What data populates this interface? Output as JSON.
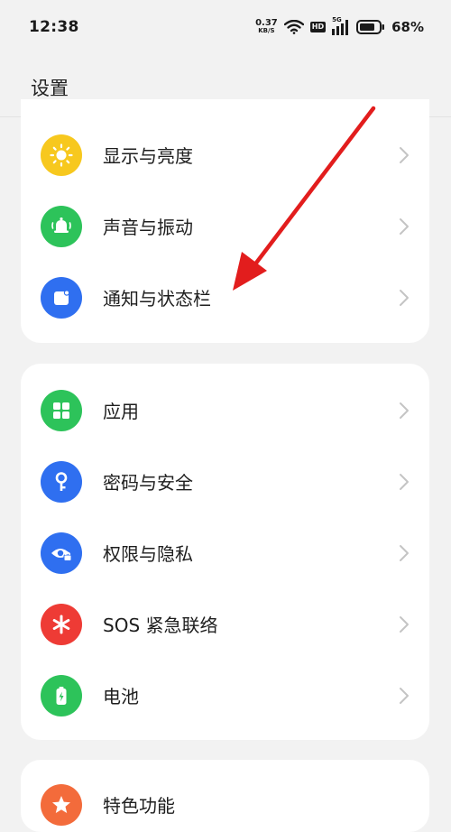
{
  "status_bar": {
    "time": "12:38",
    "net_speed_value": "0.37",
    "net_speed_unit": "KB/S",
    "hd_badge": "HD",
    "signal_label": "5G",
    "battery_percent": "68%"
  },
  "header": {
    "title": "设置"
  },
  "groups": [
    {
      "items": [
        {
          "label": "显示与亮度",
          "icon": "sun-icon",
          "color": "#f7c81e"
        },
        {
          "label": "声音与振动",
          "icon": "bell-icon",
          "color": "#2dc35a"
        },
        {
          "label": "通知与状态栏",
          "icon": "notification-icon",
          "color": "#2f6ff0"
        }
      ]
    },
    {
      "items": [
        {
          "label": "应用",
          "icon": "apps-grid-icon",
          "color": "#2dc35a"
        },
        {
          "label": "密码与安全",
          "icon": "key-icon",
          "color": "#2f6ff0"
        },
        {
          "label": "权限与隐私",
          "icon": "privacy-eye-icon",
          "color": "#2f6ff0"
        },
        {
          "label": "SOS 紧急联络",
          "icon": "asterisk-icon",
          "color": "#ee3b35"
        },
        {
          "label": "电池",
          "icon": "battery-icon",
          "color": "#2dc35a"
        }
      ]
    },
    {
      "items": [
        {
          "label": "特色功能",
          "icon": "star-icon",
          "color": "#f36b3b"
        }
      ]
    }
  ],
  "annotation": {
    "arrow_color": "#e21d1d"
  }
}
